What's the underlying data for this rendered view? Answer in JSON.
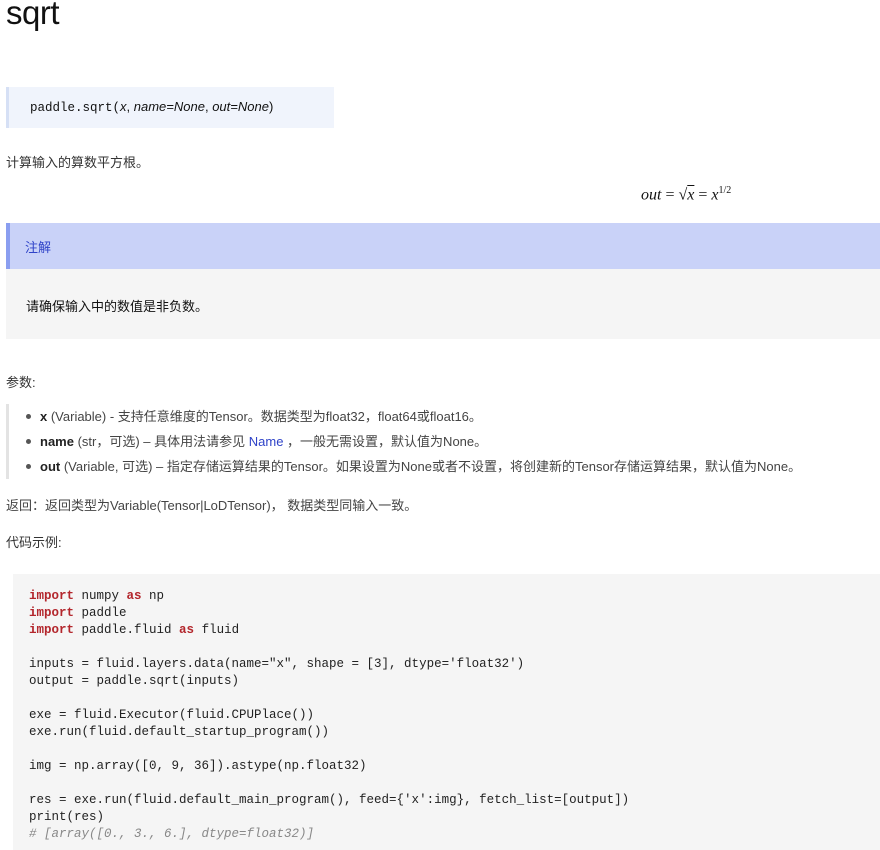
{
  "page": {
    "title": "sqrt",
    "signature": {
      "func": "paddle.sqrt(",
      "arg_x": "x",
      "sep1": ", ",
      "arg_name": "name=None",
      "sep2": ", ",
      "arg_out": "out=None",
      "close": ")"
    },
    "description": "计算输入的算数平方根。",
    "formula": {
      "lhs": "out",
      "eq1": " = ",
      "sqrt_sym": "√",
      "sqrt_arg": "x",
      "eq2": " = ",
      "base": "x",
      "exp": "1/2"
    },
    "note": {
      "heading": "注解",
      "body": "请确保输入中的数值是非负数。"
    },
    "params_label": "参数:",
    "params": [
      {
        "name": "x",
        "rest": " (Variable) - 支持任意维度的Tensor。数据类型为float32，float64或float16。"
      },
      {
        "name": "name",
        "pre": " (str，可选) – 具体用法请参见 ",
        "link": "Name",
        "post": " ，一般无需设置，默认值为None。"
      },
      {
        "name": "out",
        "rest": " (Variable, 可选) – 指定存储运算结果的Tensor。如果设置为None或者不设置，将创建新的Tensor存储运算结果，默认值为None。"
      }
    ],
    "returns": "返回：返回类型为Variable(Tensor|LoDTensor)， 数据类型同输入一致。",
    "example_label": "代码示例:",
    "code": {
      "l1_kw": "import",
      "l1_rest": " numpy ",
      "l1_kw2": "as",
      "l1_tail": " np",
      "l2_kw": "import",
      "l2_rest": " paddle",
      "l3_kw": "import",
      "l3_rest": " paddle.fluid ",
      "l3_kw2": "as",
      "l3_tail": " fluid",
      "l4": "inputs = fluid.layers.data(name=\"x\", shape = [3], dtype='float32')",
      "l5": "output = paddle.sqrt(inputs)",
      "l6": "exe = fluid.Executor(fluid.CPUPlace())",
      "l7": "exe.run(fluid.default_startup_program())",
      "l8": "img = np.array([0, 9, 36]).astype(np.float32)",
      "l9": "res = exe.run(fluid.default_main_program(), feed={'x':img}, fetch_list=[output])",
      "l10": "print(res)",
      "l11": "# [array([0., 3., 6.], dtype=float32)]"
    }
  }
}
